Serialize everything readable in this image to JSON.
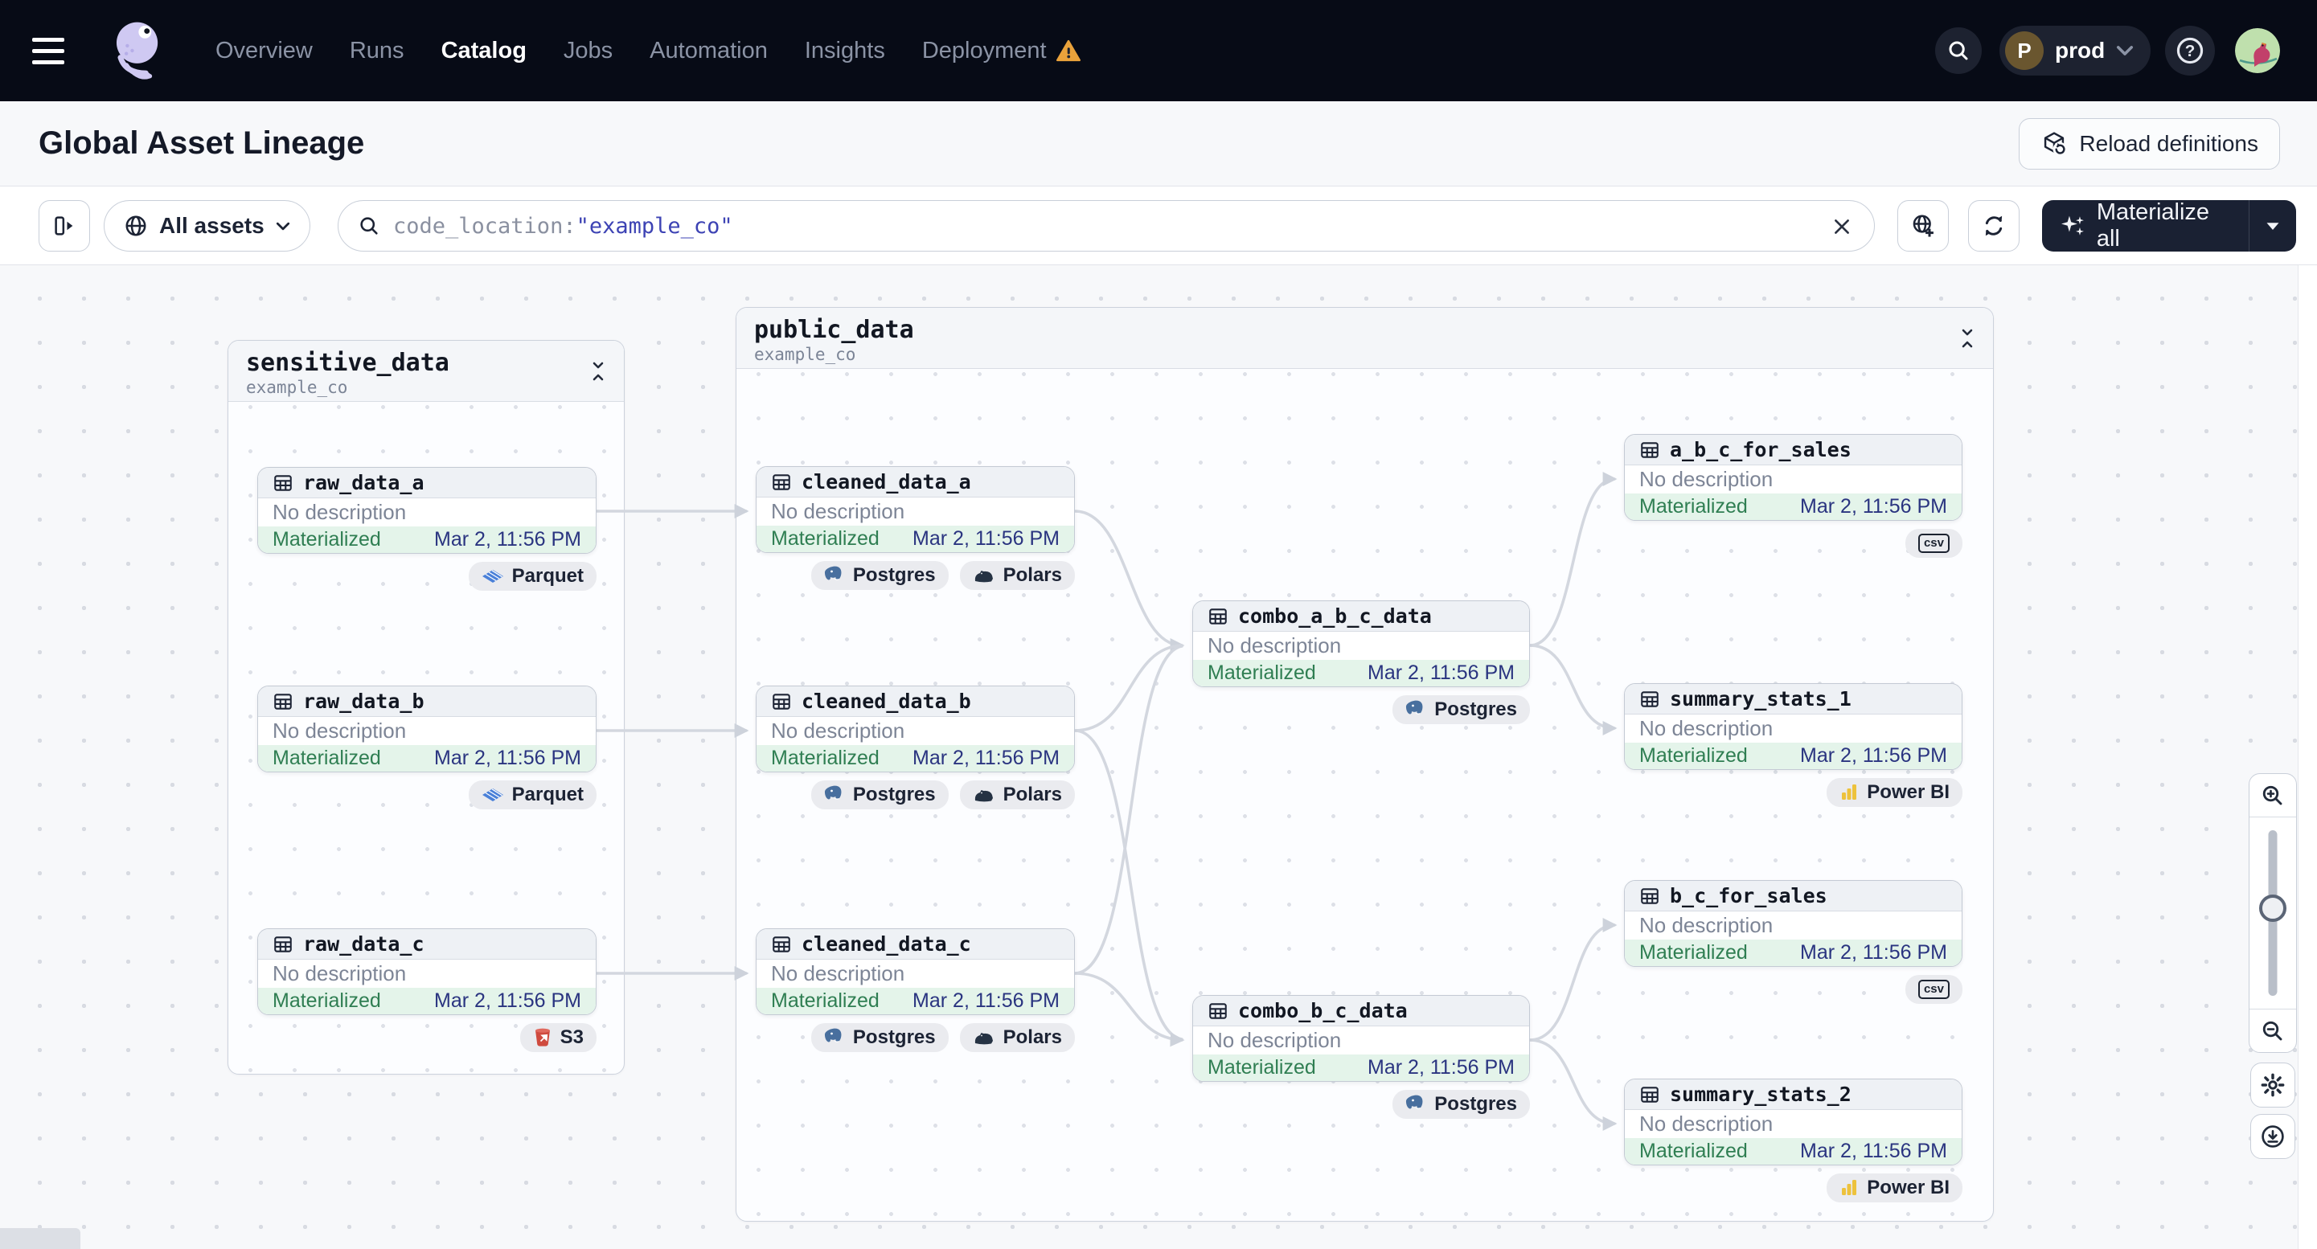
{
  "nav": {
    "items": [
      "Overview",
      "Runs",
      "Catalog",
      "Jobs",
      "Automation",
      "Insights",
      "Deployment"
    ],
    "active_item": "Catalog",
    "workspace_initial": "P",
    "workspace_name": "prod"
  },
  "page_header": {
    "title": "Global Asset Lineage",
    "reload_button": "Reload definitions"
  },
  "toolbar": {
    "scope_label": "All assets",
    "search_prefix": "code_location:",
    "search_value": "\"example_co\"",
    "materialize_label": "Materialize all"
  },
  "graph": {
    "groups": [
      {
        "name": "sensitive_data",
        "location": "example_co"
      },
      {
        "name": "public_data",
        "location": "example_co"
      }
    ],
    "node_defaults": {
      "description": "No description",
      "status": "Materialized",
      "timestamp": "Mar 2, 11:56 PM"
    },
    "nodes": [
      {
        "name": "raw_data_a",
        "tags": [
          "Parquet"
        ]
      },
      {
        "name": "raw_data_b",
        "tags": [
          "Parquet"
        ]
      },
      {
        "name": "raw_data_c",
        "tags": [
          "S3"
        ]
      },
      {
        "name": "cleaned_data_a",
        "tags": [
          "Postgres",
          "Polars"
        ]
      },
      {
        "name": "cleaned_data_b",
        "tags": [
          "Postgres",
          "Polars"
        ]
      },
      {
        "name": "cleaned_data_c",
        "tags": [
          "Postgres",
          "Polars"
        ]
      },
      {
        "name": "combo_a_b_c_data",
        "tags": [
          "Postgres"
        ]
      },
      {
        "name": "combo_b_c_data",
        "tags": [
          "Postgres"
        ]
      },
      {
        "name": "a_b_c_for_sales",
        "tags": [
          "csv"
        ]
      },
      {
        "name": "summary_stats_1",
        "tags": [
          "Power BI"
        ]
      },
      {
        "name": "b_c_for_sales",
        "tags": [
          "csv"
        ]
      },
      {
        "name": "summary_stats_2",
        "tags": [
          "Power BI"
        ]
      }
    ]
  }
}
